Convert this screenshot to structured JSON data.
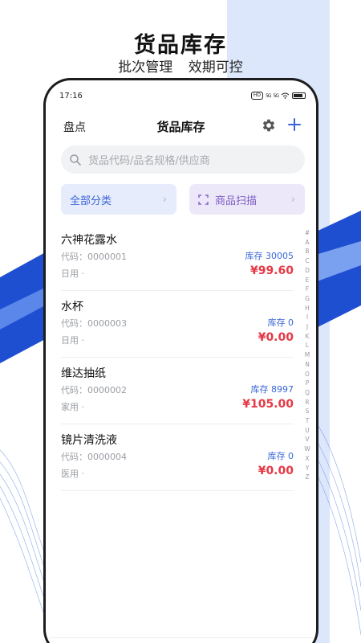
{
  "promo": {
    "title": "货品库存",
    "subtitle": "批次管理 效期可控"
  },
  "status_bar": {
    "time": "17:16",
    "hd": "HD",
    "signal": "5G",
    "signal2": "5G"
  },
  "nav": {
    "left_label": "盘点",
    "title": "货品库存",
    "settings_icon": "gear-icon",
    "add_icon": "plus-icon"
  },
  "search": {
    "placeholder": "货品代码/品名规格/供应商"
  },
  "filters": {
    "category_label": "全部分类",
    "scan_label": "商品扫描"
  },
  "items": [
    {
      "name": "六神花露水",
      "code": "代码：0000001",
      "category": "日用 ·",
      "stock": "库存  30005",
      "price": "¥99.60"
    },
    {
      "name": "水杯",
      "code": "代码：0000003",
      "category": "日用 ·",
      "stock": "库存  0",
      "price": "¥0.00"
    },
    {
      "name": "维达抽纸",
      "code": "代码：0000002",
      "category": "家用 ·",
      "stock": "库存  8997",
      "price": "¥105.00"
    },
    {
      "name": "镜片清洗液",
      "code": "代码：0000004",
      "category": "医用 ·",
      "stock": "库存  0",
      "price": "¥0.00"
    }
  ],
  "alphabet": [
    "#",
    "A",
    "B",
    "C",
    "D",
    "E",
    "F",
    "G",
    "H",
    "I",
    "J",
    "K",
    "L",
    "M",
    "N",
    "O",
    "P",
    "Q",
    "R",
    "S",
    "T",
    "U",
    "V",
    "W",
    "X",
    "Y",
    "Z"
  ],
  "colors": {
    "accent_blue": "#3b63d8",
    "price_red": "#e63946",
    "bg_wave_blue": "#1f4fd1"
  }
}
